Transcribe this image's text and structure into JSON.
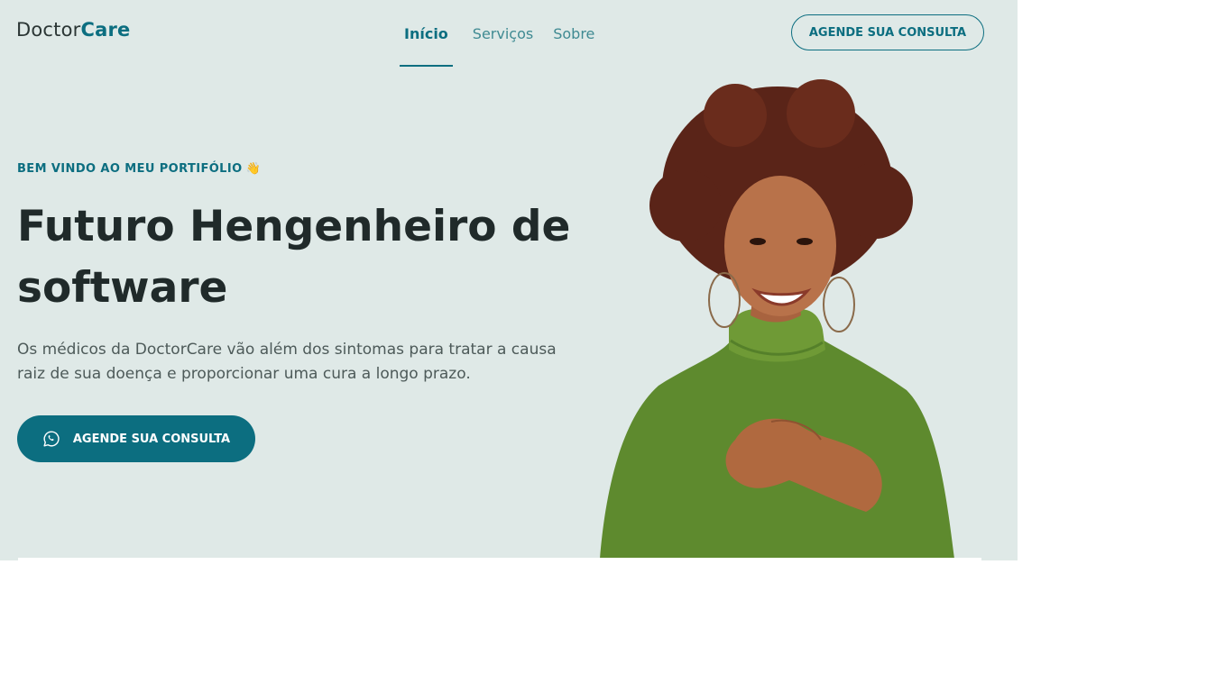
{
  "header": {
    "logo_part1": "Doctor",
    "logo_part2": "Care",
    "nav": [
      "Início",
      "Serviços",
      "Sobre"
    ],
    "active_nav": "Início",
    "cta": "AGENDE SUA CONSULTA"
  },
  "hero": {
    "eyebrow": "BEM VINDO AO MEU PORTIFÓLIO",
    "eyebrow_icon": "waving-hand-icon",
    "title": "Futuro Hengenheiro de software",
    "description": "Os médicos da DoctorCare vão além dos sintomas para tratar a causa raiz de sua doença e proporcionar uma cura a longo prazo.",
    "cta": "AGENDE SUA CONSULTA",
    "cta_icon": "whatsapp-icon",
    "image": "woman-green-sweater"
  },
  "colors": {
    "brand": "#0c6e80",
    "hero_background": "#dfe9e7",
    "text_dark": "#202a2a"
  }
}
